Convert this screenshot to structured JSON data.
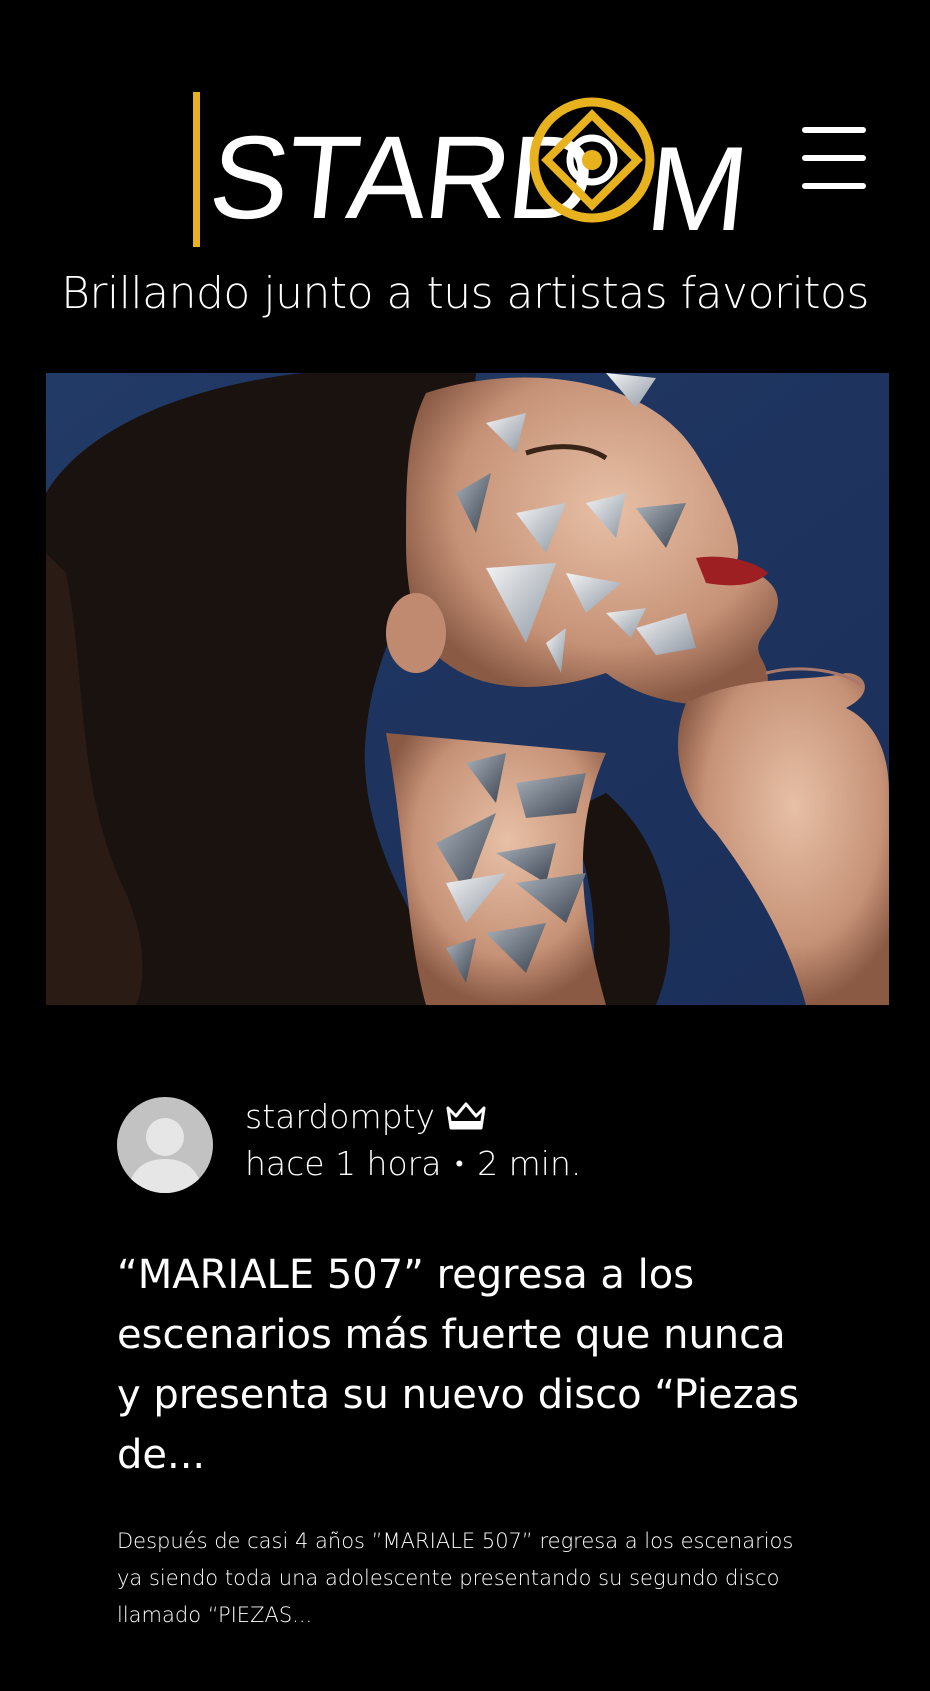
{
  "header": {
    "logo_text": "STARDOM",
    "tagline": "Brillando junto a tus artistas favoritos",
    "menu_icon": "hamburger-menu-icon"
  },
  "colors": {
    "background": "#000000",
    "accent": "#e8b21f",
    "text": "#ffffff",
    "avatar": "#c2c2c2"
  },
  "post": {
    "author": "stardompty",
    "author_badge_icon": "crown-icon",
    "time_ago": "hace 1 hora",
    "separator": "•",
    "read_time": "2 min.",
    "title": "“MARIALE 507” regresa a los escenarios más fuerte que nunca y presenta su nuevo disco “Piezas de...",
    "excerpt": "Después de casi 4 años ”MARIALE 507” regresa a los escenarios ya siendo toda una adolescente presentando su segundo disco llamado “PIEZAS..."
  }
}
